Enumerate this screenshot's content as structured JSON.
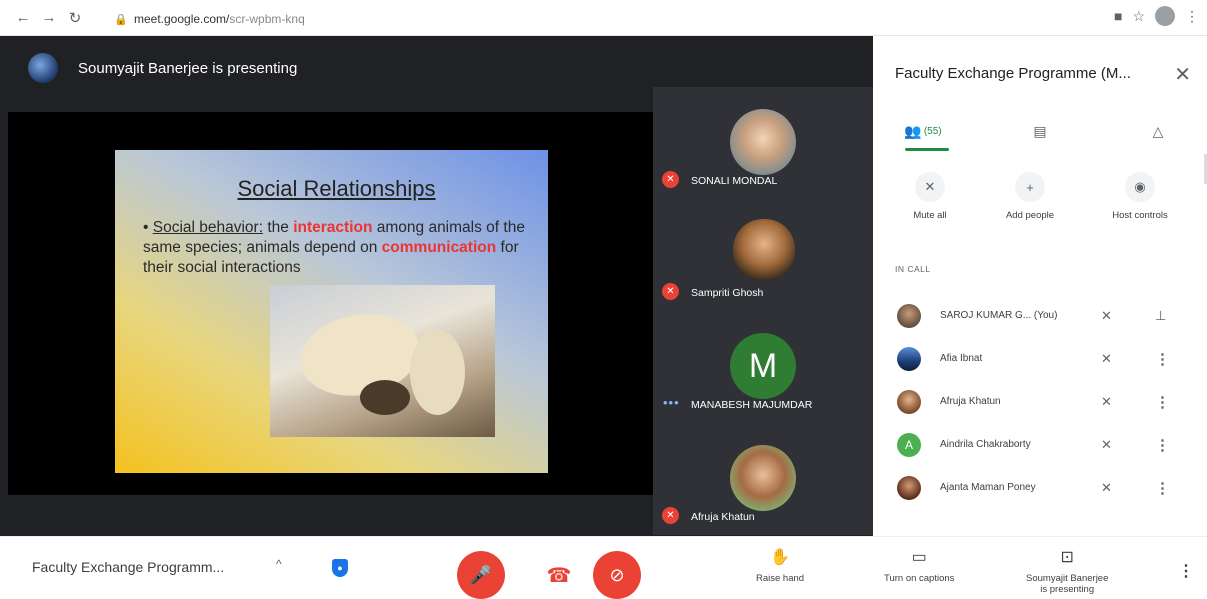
{
  "browser": {
    "url_host": "meet.google.com/",
    "url_path": "scr-wpbm-knq"
  },
  "presenter_banner": "Soumyajit Banerjee is presenting",
  "slide": {
    "title": "Social Relationships",
    "bullet_lead": "Social behavior:",
    "bullet_part1": " the ",
    "bullet_highlight1": "interaction",
    "bullet_part2": " among animals of the same species; animals depend on ",
    "bullet_highlight2": "communication",
    "bullet_part3": " for their social interactions"
  },
  "tiles": [
    {
      "name": "SONALI MONDAL",
      "status": "muted"
    },
    {
      "name": "Sampriti Ghosh",
      "status": "muted"
    },
    {
      "name": "MANABESH MAJUMDAR",
      "status": "speaking",
      "initial": "M"
    },
    {
      "name": "Afruja Khatun",
      "status": "muted"
    }
  ],
  "panel": {
    "title": "Faculty Exchange Programme (M...",
    "people_count": "(55)",
    "actions": [
      "Mute all",
      "Add people",
      "Host controls"
    ],
    "section_label": "IN CALL",
    "people": [
      {
        "name": "SAROJ KUMAR G...",
        "suffix": "(You)"
      },
      {
        "name": "Afia Ibnat"
      },
      {
        "name": "Afruja Khatun"
      },
      {
        "name": "Aindrila Chakraborty",
        "initial": "A"
      },
      {
        "name": "Ajanta Maman Poney"
      }
    ]
  },
  "bottom": {
    "meeting_name": "Faculty Exchange Programm...",
    "raise_hand": "Raise hand",
    "captions": "Turn on captions",
    "presenting_line1": "Soumyajit Banerjee",
    "presenting_line2": "is presenting"
  },
  "colors": {
    "stage_bg": "#202124",
    "tile_bg": "#2f3136",
    "red": "#ea4335",
    "accent_green": "#1e8e3e"
  }
}
